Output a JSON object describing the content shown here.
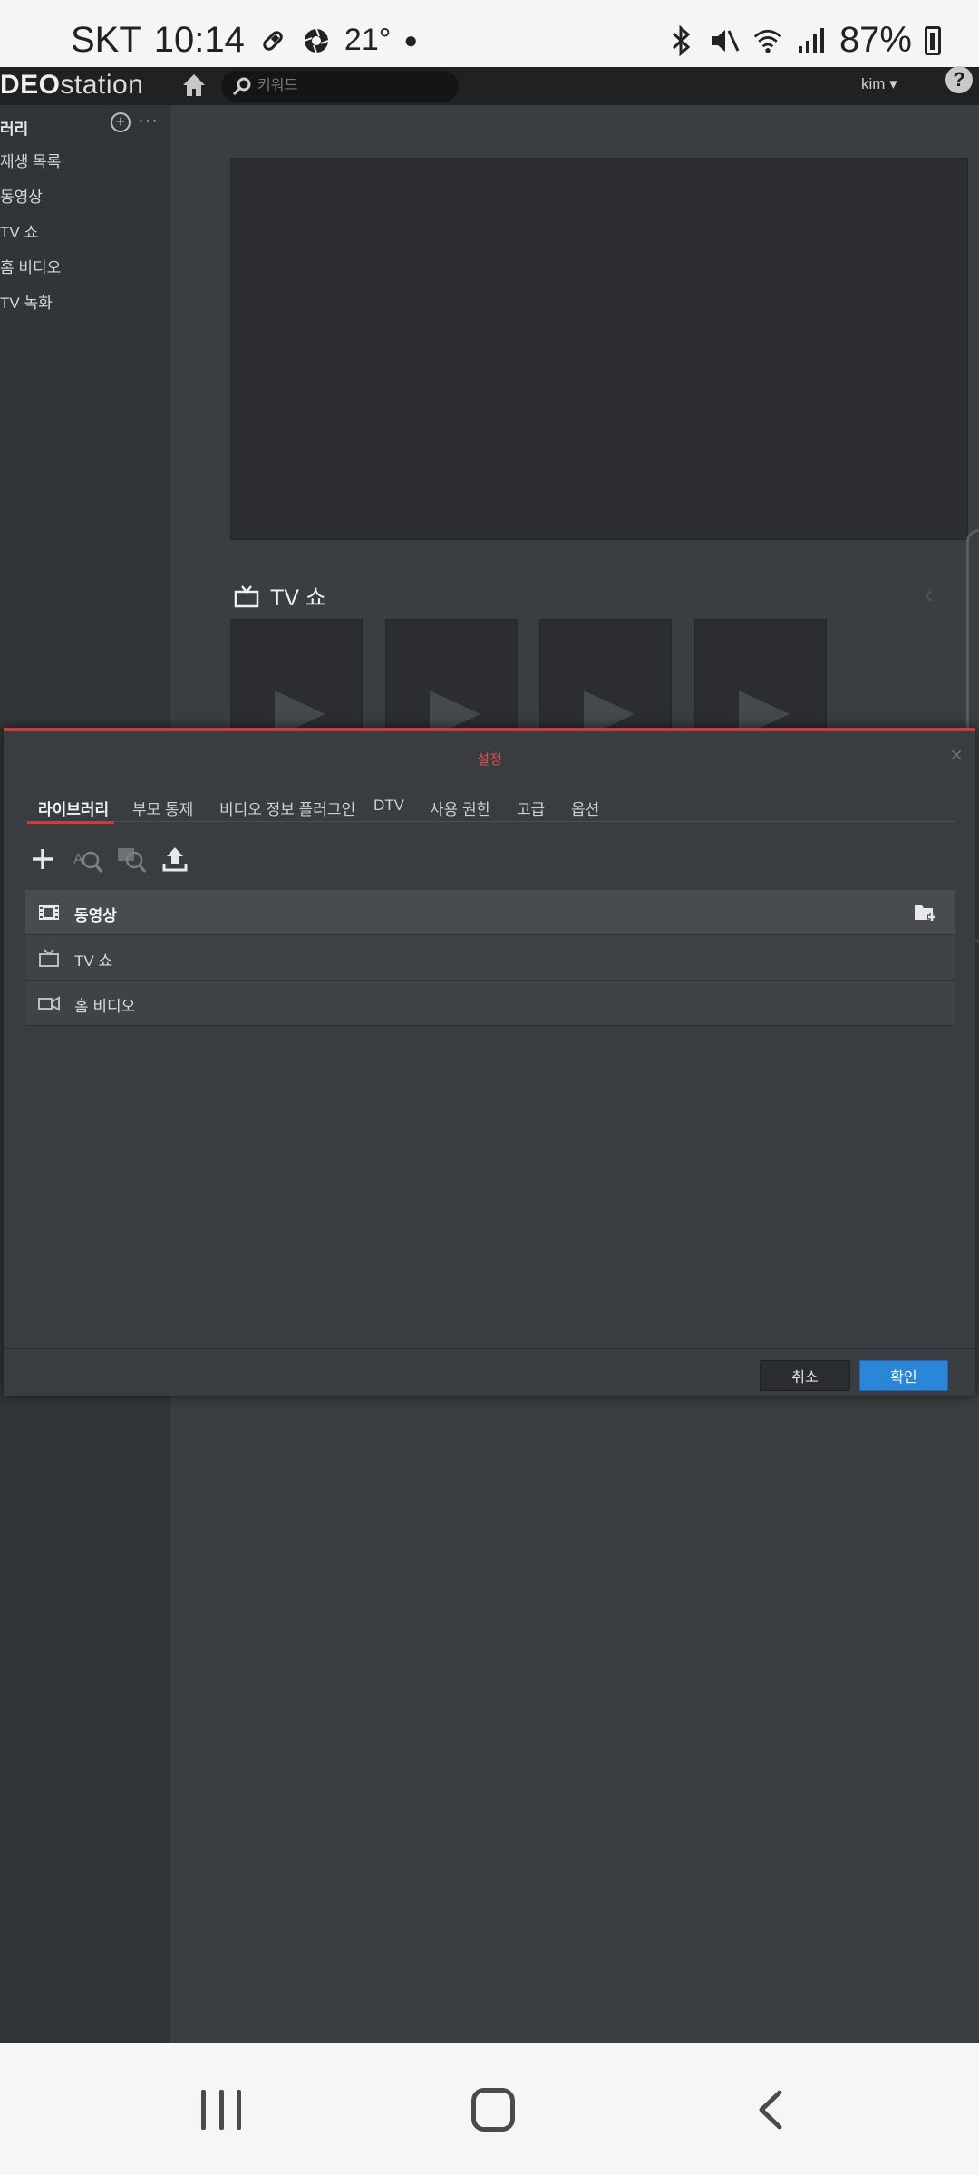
{
  "status_bar": {
    "carrier": "SKT",
    "time": "10:14",
    "temperature": "21°",
    "battery": "87%"
  },
  "header": {
    "logo_bold": "DEO",
    "logo_rest": "station",
    "search_placeholder": "키워드",
    "user": "kim ▾",
    "help": "?"
  },
  "sidebar": {
    "title": "러리",
    "items": [
      {
        "label": "재생 목록"
      },
      {
        "label": "동영상"
      },
      {
        "label": "TV 쇼"
      },
      {
        "label": "홈 비디오"
      },
      {
        "label": "TV 녹화"
      }
    ]
  },
  "main": {
    "section_title": "TV 쇼",
    "thumbnail_count": 4
  },
  "modal": {
    "title": "설정",
    "close": "×",
    "tabs": [
      {
        "label": "라이브러리",
        "active": true
      },
      {
        "label": "부모 통제",
        "active": false
      },
      {
        "label": "비디오 정보 플러그인",
        "active": false
      },
      {
        "label": "DTV",
        "active": false
      },
      {
        "label": "사용 권한",
        "active": false
      },
      {
        "label": "고급",
        "active": false
      },
      {
        "label": "옵션",
        "active": false
      }
    ],
    "toolbar": [
      "add-icon",
      "rename-search-icon",
      "search-image-icon",
      "upload-icon"
    ],
    "libraries": [
      {
        "label": "동영상",
        "icon": "film-icon",
        "selected": true
      },
      {
        "label": "TV 쇼",
        "icon": "tv-icon",
        "selected": false
      },
      {
        "label": "홈 비디오",
        "icon": "camcorder-icon",
        "selected": false
      }
    ],
    "cancel_label": "취소",
    "confirm_label": "확인"
  },
  "colors": {
    "accent_red": "#d23a3a",
    "confirm_blue": "#2b86d8",
    "background": "#3a3d41"
  }
}
